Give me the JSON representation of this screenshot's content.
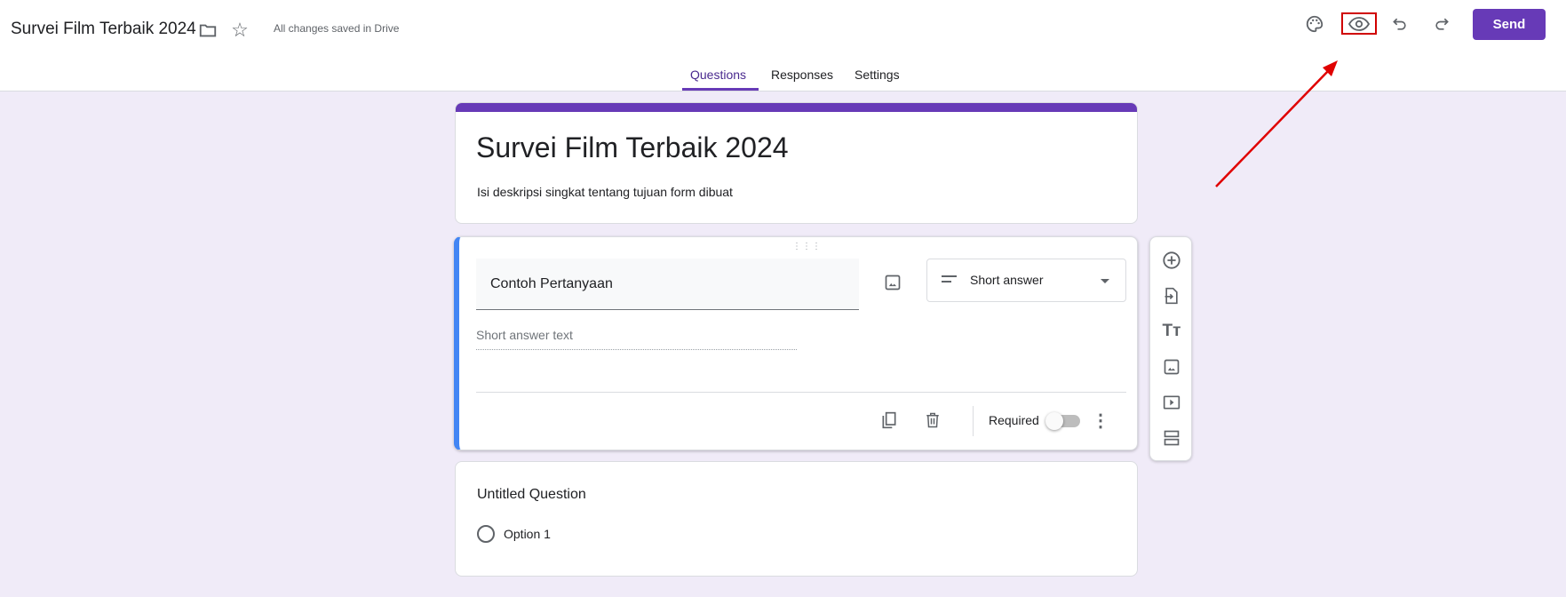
{
  "header": {
    "title": "Survei Film Terbaik 2024",
    "save_status": "All changes saved in Drive",
    "send_label": "Send",
    "icons": [
      "folder-icon",
      "star-icon",
      "palette-icon",
      "eye-icon",
      "undo-icon",
      "redo-icon"
    ]
  },
  "tabs": [
    {
      "label": "Questions",
      "active": true
    },
    {
      "label": "Responses",
      "active": false
    },
    {
      "label": "Settings",
      "active": false
    }
  ],
  "form": {
    "title": "Survei Film Terbaik 2024",
    "description": "Isi deskripsi singkat tentang tujuan form dibuat"
  },
  "question1": {
    "title": "Contoh Pertanyaan",
    "type": "Short answer",
    "answer_placeholder": "Short answer text",
    "required_label": "Required",
    "required": false
  },
  "question2": {
    "title": "Untitled Question",
    "option": "Option 1"
  },
  "colors": {
    "accent": "#673ab7",
    "active_question": "#4285f4",
    "annotation": "#e00000",
    "background": "#f0ebf8"
  }
}
